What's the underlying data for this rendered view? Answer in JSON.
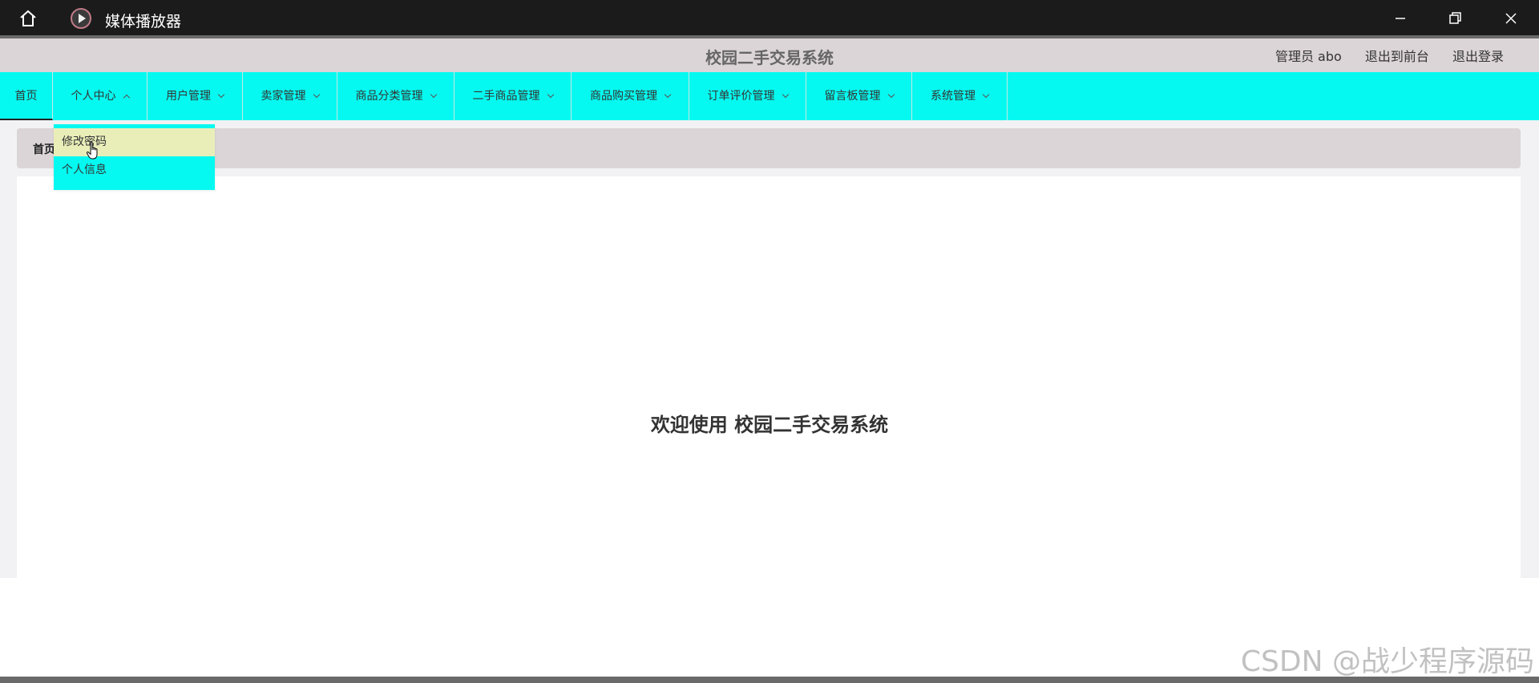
{
  "window": {
    "title": "媒体播放器",
    "icons": {
      "home": "home-icon",
      "app": "play-icon",
      "minimize": "minimize-icon",
      "maximize": "restore-icon",
      "close": "close-icon"
    }
  },
  "header": {
    "site_title": "校园二手交易系统",
    "user_label": "管理员 abo",
    "front_link": "退出到前台",
    "logout_link": "退出登录"
  },
  "nav": {
    "items": [
      {
        "label": "首页"
      },
      {
        "label": "个人中心"
      },
      {
        "label": "用户管理"
      },
      {
        "label": "卖家管理"
      },
      {
        "label": "商品分类管理"
      },
      {
        "label": "二手商品管理"
      },
      {
        "label": "商品购买管理"
      },
      {
        "label": "订单评价管理"
      },
      {
        "label": "留言板管理"
      },
      {
        "label": "系统管理"
      }
    ],
    "colors": {
      "nav_bg": "#06f9f0",
      "header_bg": "#dcd5d7",
      "hover_bg": "#e9eeb9"
    }
  },
  "dropdown": {
    "items": [
      {
        "label": "修改密码"
      },
      {
        "label": "个人信息"
      }
    ]
  },
  "breadcrumb": {
    "current": "首页"
  },
  "main": {
    "welcome": "欢迎使用 校园二手交易系统"
  },
  "watermark": "CSDN @战少程序源码"
}
